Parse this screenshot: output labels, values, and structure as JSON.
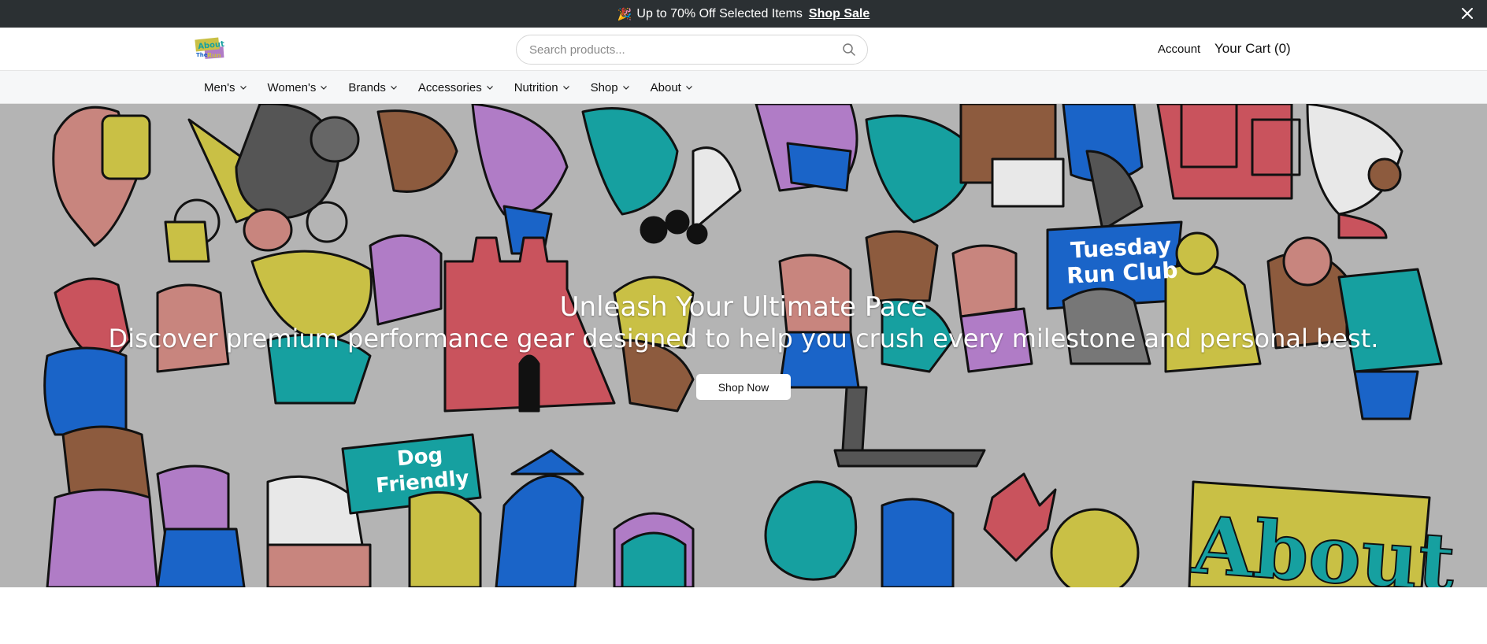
{
  "announcement": {
    "icon": "party-popper-icon",
    "message": "Up to 70% Off Selected Items",
    "link_label": "Shop Sale"
  },
  "header": {
    "logo_alt": "About The Run",
    "search_placeholder": "Search products...",
    "account_label": "Account",
    "cart_label": "Your Cart (0)"
  },
  "nav": {
    "items": [
      {
        "label": "Men's"
      },
      {
        "label": "Women's"
      },
      {
        "label": "Brands"
      },
      {
        "label": "Accessories"
      },
      {
        "label": "Nutrition"
      },
      {
        "label": "Shop"
      },
      {
        "label": "About"
      }
    ]
  },
  "hero": {
    "title": "Unleash Your Ultimate Pace",
    "subtitle": "Discover premium performance gear designed to help you crush every milestone and personal best.",
    "cta_label": "Shop Now",
    "banner_1": "Tuesday",
    "banner_2": "Run Club",
    "flag_1": "Dog",
    "flag_2": "Friendly",
    "sign_text": "About"
  },
  "colors": {
    "announcement_bg": "#2b3033",
    "hero_bg": "#b4b4b4",
    "accent_teal": "#16a0a0",
    "accent_blue": "#1a64c8",
    "accent_yellow": "#c9c045",
    "accent_red": "#c9535d",
    "accent_pink": "#c8857e",
    "accent_purple": "#b07cc6"
  }
}
